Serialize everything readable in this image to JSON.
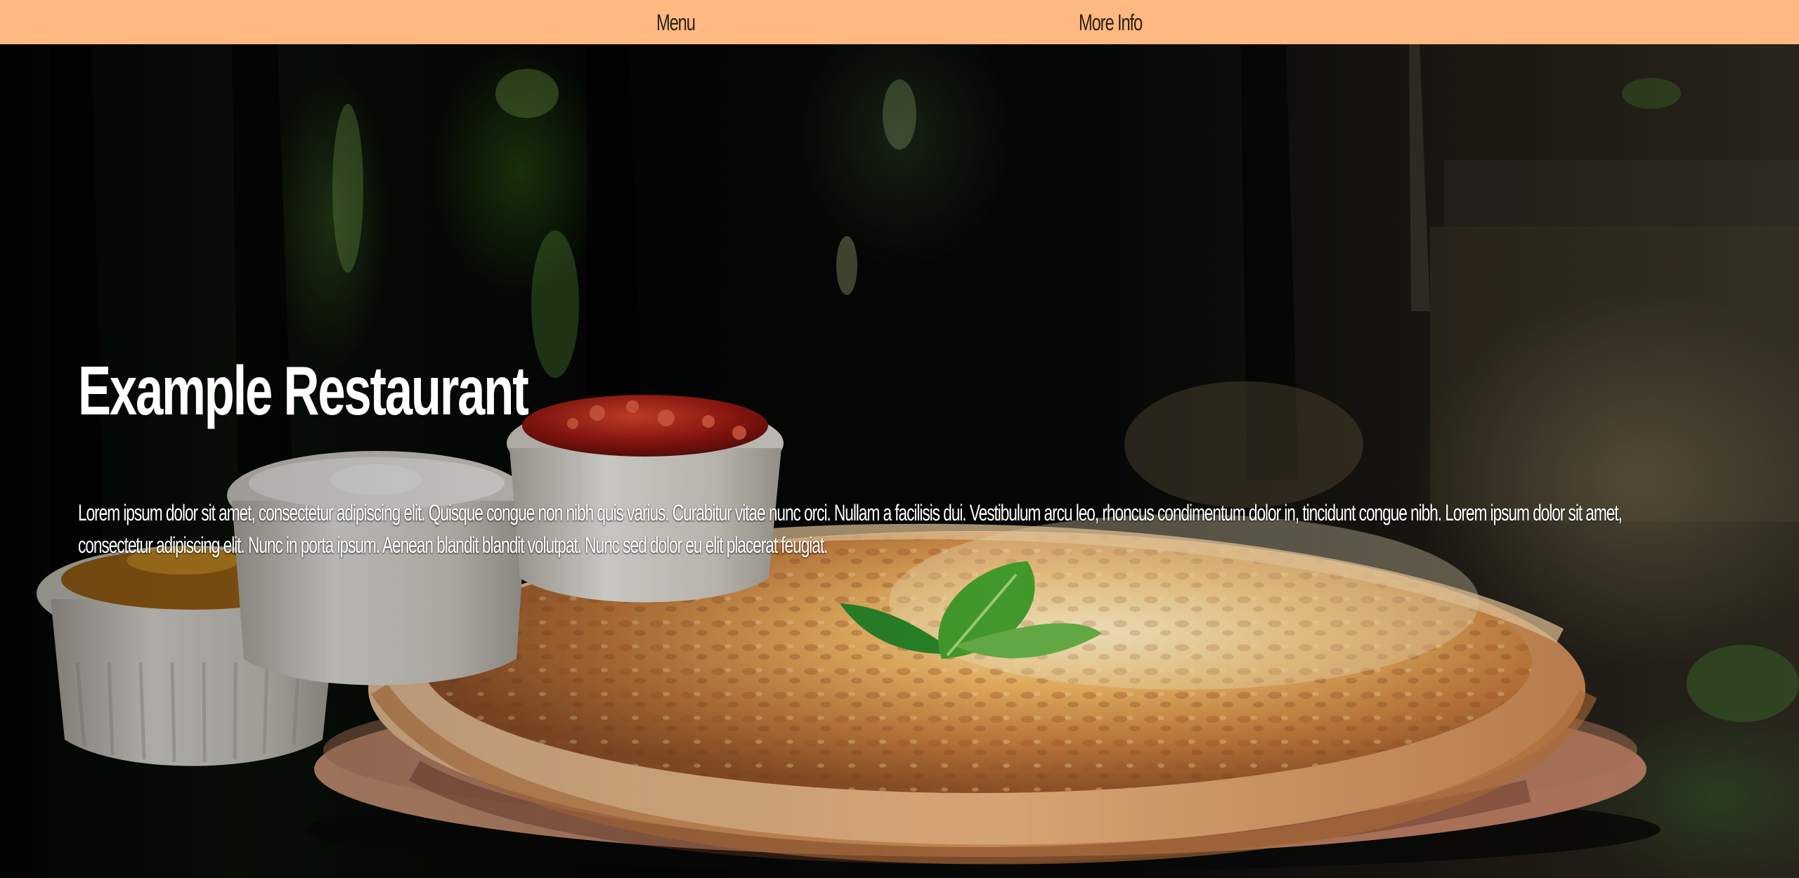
{
  "navbar": {
    "menu_label": "Menu",
    "more_info_label": "More Info",
    "background": "#ffb980"
  },
  "hero": {
    "title": "Example Restaurant",
    "description": "Lorem ipsum dolor sit amet, consectetur adipiscing elit. Quisque congue non nibh quis varius. Curabitur vitae nunc orci. Nullam a facilisis dui. Vestibulum arcu leo, rhoncus condimentum dolor in, tincidunt congue nibh. Lorem ipsum dolor sit amet, consectetur adipiscing elit. Nunc in porta ipsum. Aenean blandit blandit volutpat. Nunc sed dolor eu elit placerat feugiat.",
    "image_subject": "cheese pizza with basil leaf on wooden board, small white bowls of sauces"
  },
  "colors": {
    "text": "#ffffff",
    "nav_text": "#2a2119",
    "background": "#050705"
  }
}
